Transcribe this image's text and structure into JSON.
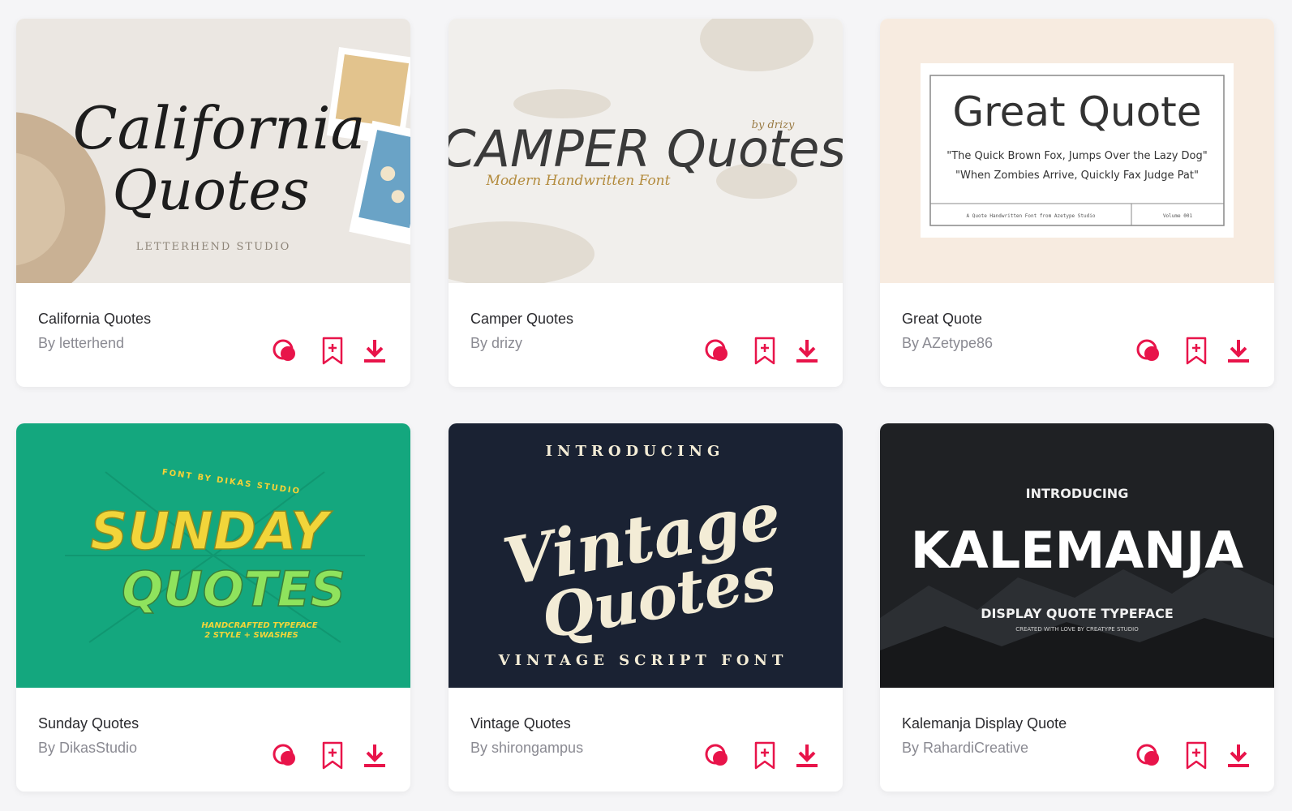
{
  "colors": {
    "accent": "#e8144a",
    "title": "#2a2a2e",
    "author": "#8a8a92",
    "background": "#f5f5f7"
  },
  "icons": {
    "compare": "compare-circles-icon",
    "save": "bookmark-add-icon",
    "download": "download-icon"
  },
  "cards": [
    {
      "title": "California Quotes",
      "author": "By letterhend",
      "preview": {
        "line1": "California",
        "line2": "Quotes",
        "studio": "LETTERHEND STUDIO"
      }
    },
    {
      "title": "Camper Quotes",
      "author": "By drizy",
      "preview": {
        "main": "CAMPER Quotes",
        "byline": "by drizy",
        "sub": "Modern Handwritten Font"
      }
    },
    {
      "title": "Great Quote",
      "author": "By AZetype86",
      "preview": {
        "main": "Great Quote",
        "quote1": "\"The Quick Brown Fox, Jumps Over the Lazy Dog\"",
        "quote2": "\"When Zombies Arrive, Quickly Fax Judge Pat\"",
        "footer_left": "A Quote Handwritten Font from Azetype Studio",
        "footer_right": "Volume 001"
      }
    },
    {
      "title": "Sunday Quotes",
      "author": "By DikasStudio",
      "preview": {
        "top": "FONT BY DIKAS STUDIO",
        "line1": "SUNDAY",
        "line2": "QUOTES",
        "sub1": "HANDCRAFTED TYPEFACE",
        "sub2": "2 STYLE + SWASHES"
      }
    },
    {
      "title": "Vintage Quotes",
      "author": "By shirongampus",
      "preview": {
        "top": "INTRODUCING",
        "line1": "Vintage",
        "line2": "Quotes",
        "bottom": "VINTAGE SCRIPT FONT"
      }
    },
    {
      "title": "Kalemanja Display Quote",
      "author": "By RahardiCreative",
      "preview": {
        "top": "INTRODUCING",
        "main": "KALEMANJA",
        "sub": "DISPLAY QUOTE TYPEFACE",
        "credit": "CREATED WITH LOVE BY CREATYPE STUDIO"
      }
    }
  ]
}
